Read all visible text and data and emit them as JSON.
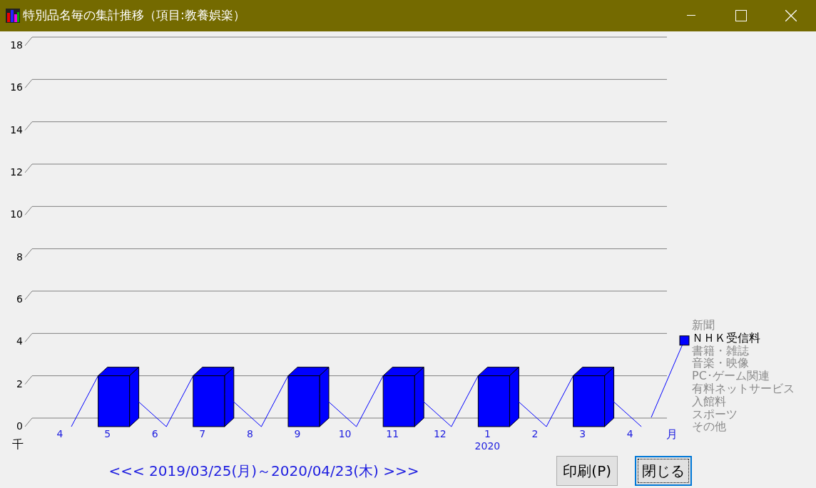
{
  "window": {
    "title": "特別品名毎の集計推移（項目:教養娯楽）"
  },
  "chart": {
    "unit_label": "千",
    "x_unit_label": "月",
    "year_label": "2020",
    "chart_data": {
      "type": "bar",
      "categories": [
        "4",
        "5",
        "6",
        "7",
        "8",
        "9",
        "10",
        "11",
        "12",
        "1",
        "2",
        "3",
        "4"
      ],
      "series": [
        {
          "name": "ＮＨＫ受信料",
          "color": "#0000ff",
          "values": [
            0,
            2,
            0,
            2,
            0,
            2,
            0,
            2,
            0,
            2,
            0,
            2,
            0
          ]
        }
      ],
      "ylim": [
        0,
        18
      ],
      "yticks": [
        0,
        2,
        4,
        6,
        8,
        10,
        12,
        14,
        16,
        18
      ]
    }
  },
  "legend": [
    {
      "label": "新聞",
      "active": false
    },
    {
      "kind": "series",
      "active": true
    },
    {
      "label": "書籍・雑誌",
      "active": false
    },
    {
      "label": "音楽・映像",
      "active": false
    },
    {
      "label": "PC･ゲーム関連",
      "active": false
    },
    {
      "label": "有料ネットサービス",
      "active": false
    },
    {
      "label": "入館料",
      "active": false
    },
    {
      "label": "スポーツ",
      "active": false
    },
    {
      "label": "その他",
      "active": false
    }
  ],
  "period": "<<< 2019/03/25(月)～2020/04/23(木) >>>",
  "buttons": [
    {
      "label": "印刷(P)",
      "focused": false
    },
    {
      "label": "閉じる",
      "focused": true
    }
  ]
}
